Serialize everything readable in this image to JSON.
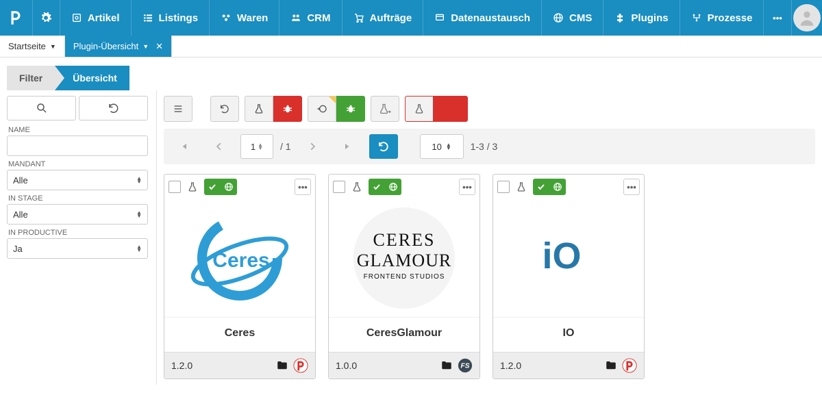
{
  "colors": {
    "brand": "#1a8dc1",
    "danger": "#d9302c",
    "ok": "#44a135",
    "warn": "#f5c84c"
  },
  "topnav": {
    "items": [
      {
        "label": "Artikel",
        "icon": "article"
      },
      {
        "label": "Listings",
        "icon": "listings"
      },
      {
        "label": "Waren",
        "icon": "stock"
      },
      {
        "label": "CRM",
        "icon": "crm"
      },
      {
        "label": "Aufträge",
        "icon": "orders"
      },
      {
        "label": "Datenaustausch",
        "icon": "exchange"
      },
      {
        "label": "CMS",
        "icon": "cms"
      },
      {
        "label": "Plugins",
        "icon": "plugins"
      },
      {
        "label": "Prozesse",
        "icon": "processes"
      }
    ],
    "more": "•••"
  },
  "breadcrumb": {
    "start": "Startseite",
    "active": "Plugin-Übersicht"
  },
  "tabs": {
    "filter": "Filter",
    "overview": "Übersicht"
  },
  "filter": {
    "name_label": "NAME",
    "name_value": "",
    "mandant_label": "MANDANT",
    "mandant_value": "Alle",
    "stage_label": "IN STAGE",
    "stage_value": "Alle",
    "prod_label": "IN PRODUCTIVE",
    "prod_value": "Ja"
  },
  "pager": {
    "page_input": "1",
    "page_sep": "/ 1",
    "page_size": "10",
    "range": "1-3 / 3"
  },
  "plugins": [
    {
      "name": "Ceres",
      "version": "1.2.0",
      "source": "plenty",
      "logo": "ceres",
      "stage_checked": true
    },
    {
      "name": "CeresGlamour",
      "version": "1.0.0",
      "source": "fs",
      "logo": "glamour",
      "stage_checked": true
    },
    {
      "name": "IO",
      "version": "1.2.0",
      "source": "plenty",
      "logo": "io",
      "stage_checked": true
    }
  ]
}
